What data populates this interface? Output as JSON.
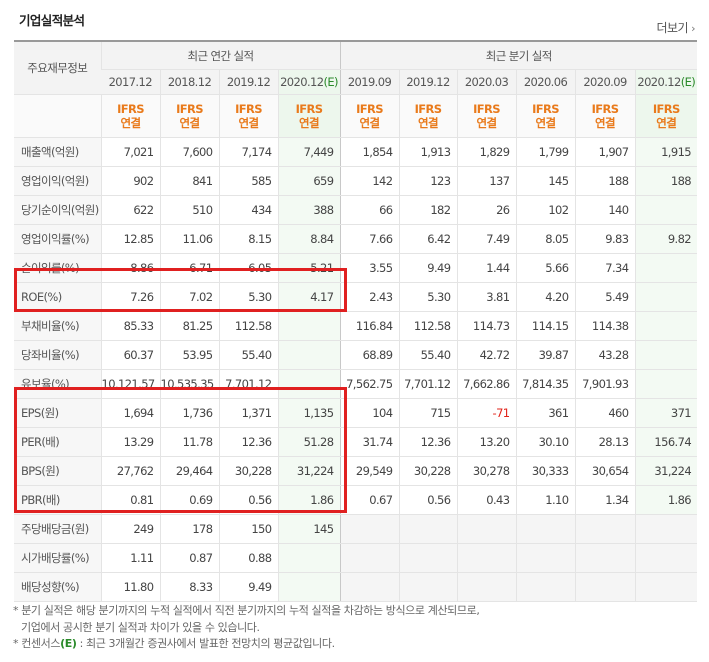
{
  "header": {
    "title": "기업실적분석",
    "more_label": "더보기",
    "more_icon": "chevron-right-icon"
  },
  "table": {
    "corner_label": "주요재무정보",
    "annual_group_label": "최근 연간 실적",
    "quarterly_group_label": "최근 분기 실적",
    "estimate_mark": "(E)",
    "annual_periods": [
      {
        "date": "2017.12",
        "estimate": false
      },
      {
        "date": "2018.12",
        "estimate": false
      },
      {
        "date": "2019.12",
        "estimate": false
      },
      {
        "date": "2020.12",
        "estimate": true
      }
    ],
    "quarterly_periods": [
      {
        "date": "2019.09",
        "estimate": false
      },
      {
        "date": "2019.12",
        "estimate": false
      },
      {
        "date": "2020.03",
        "estimate": false
      },
      {
        "date": "2020.06",
        "estimate": false
      },
      {
        "date": "2020.09",
        "estimate": false
      },
      {
        "date": "2020.12",
        "estimate": true
      }
    ],
    "standard_line1": "IFRS",
    "standard_line2": "연결",
    "rows": [
      {
        "label": "매출액(억원)",
        "values": [
          "7,021",
          "7,600",
          "7,174",
          "7,449",
          "1,854",
          "1,913",
          "1,829",
          "1,799",
          "1,907",
          "1,915"
        ]
      },
      {
        "label": "영업이익(억원)",
        "values": [
          "902",
          "841",
          "585",
          "659",
          "142",
          "123",
          "137",
          "145",
          "188",
          "188"
        ]
      },
      {
        "label": "당기순이익(억원)",
        "values": [
          "622",
          "510",
          "434",
          "388",
          "66",
          "182",
          "26",
          "102",
          "140",
          ""
        ]
      },
      {
        "label": "영업이익률(%)",
        "values": [
          "12.85",
          "11.06",
          "8.15",
          "8.84",
          "7.66",
          "6.42",
          "7.49",
          "8.05",
          "9.83",
          "9.82"
        ]
      },
      {
        "label": "순이익률(%)",
        "values": [
          "8.86",
          "6.71",
          "6.05",
          "5.21",
          "3.55",
          "9.49",
          "1.44",
          "5.66",
          "7.34",
          ""
        ]
      },
      {
        "label": "ROE(%)",
        "values": [
          "7.26",
          "7.02",
          "5.30",
          "4.17",
          "2.43",
          "5.30",
          "3.81",
          "4.20",
          "5.49",
          ""
        ]
      },
      {
        "label": "부채비율(%)",
        "values": [
          "85.33",
          "81.25",
          "112.58",
          "",
          "116.84",
          "112.58",
          "114.73",
          "114.15",
          "114.38",
          ""
        ]
      },
      {
        "label": "당좌비율(%)",
        "values": [
          "60.37",
          "53.95",
          "55.40",
          "",
          "68.89",
          "55.40",
          "42.72",
          "39.87",
          "43.28",
          ""
        ]
      },
      {
        "label": "유보율(%)",
        "values": [
          "10,121.57",
          "10,535.35",
          "7,701.12",
          "",
          "7,562.75",
          "7,701.12",
          "7,662.86",
          "7,814.35",
          "7,901.93",
          ""
        ]
      },
      {
        "label": "EPS(원)",
        "values": [
          "1,694",
          "1,736",
          "1,371",
          "1,135",
          "104",
          "715",
          "-71",
          "361",
          "460",
          "371"
        ]
      },
      {
        "label": "PER(배)",
        "values": [
          "13.29",
          "11.78",
          "12.36",
          "51.28",
          "31.74",
          "12.36",
          "13.20",
          "30.10",
          "28.13",
          "156.74"
        ]
      },
      {
        "label": "BPS(원)",
        "values": [
          "27,762",
          "29,464",
          "30,228",
          "31,224",
          "29,549",
          "30,228",
          "30,278",
          "30,333",
          "30,654",
          "31,224"
        ]
      },
      {
        "label": "PBR(배)",
        "values": [
          "0.81",
          "0.69",
          "0.56",
          "1.86",
          "0.67",
          "0.56",
          "0.43",
          "1.10",
          "1.34",
          "1.86"
        ]
      },
      {
        "label": "주당배당금(원)",
        "values": [
          "249",
          "178",
          "150",
          "145",
          "",
          "",
          "",
          "",
          "",
          ""
        ]
      },
      {
        "label": "시가배당률(%)",
        "values": [
          "1.11",
          "0.87",
          "0.88",
          "",
          "",
          "",
          "",
          "",
          "",
          ""
        ]
      },
      {
        "label": "배당성향(%)",
        "values": [
          "11.80",
          "8.33",
          "9.49",
          "",
          "",
          "",
          "",
          "",
          "",
          ""
        ]
      }
    ]
  },
  "colors": {
    "negative": "#e2231a",
    "ifrs": "#e97a1b",
    "estimate": "#2a8a2a",
    "highlight_box": "#e02020"
  },
  "notes": {
    "line1": "분기 실적은 해당 분기까지의 누적 실적에서 직전 분기까지의 누적 실적을 차감하는 방식으로 계산되므로,",
    "line2": "기업에서 공시한 분기 실적과 차이가 있을 수 있습니다.",
    "line3_prefix": "컨센서스",
    "line3_mark": "(E)",
    "line3_suffix": ": 최근 3개월간 증권사에서 발표한 전망치의 평균값입니다."
  }
}
